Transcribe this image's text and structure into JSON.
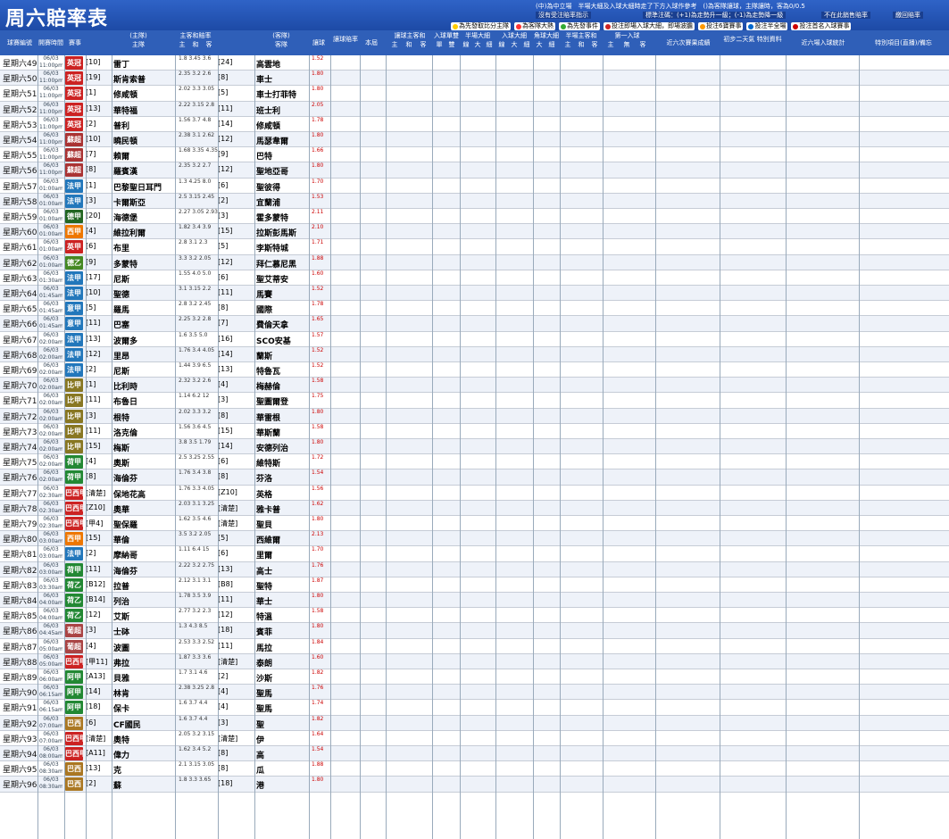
{
  "header": {
    "title": "周六賠率表",
    "note1": "(中)為中立場　半場大細及入球大細時走了下方入球作參考　()為客隊讓球，主隊讓時，客為0/0.5",
    "note2": "沒有受注賠率指示",
    "note3": "標準注碼：(+1)為走勢升一級；(-1)為走勢降一級",
    "note4": "不在此銷售賠率",
    "note5": "繳回賠率",
    "legend": [
      {
        "label": "為先發取比分主隊",
        "color": "#ffcc00"
      },
      {
        "label": "為客隊大熱",
        "color": "#ff3333"
      },
      {
        "label": "為先發事件",
        "color": "#33aa33"
      },
      {
        "label": "投注即場入球大細，即場波膽",
        "color": "#cc2222"
      },
      {
        "label": "投注6寶賽事",
        "color": "#ff9900"
      },
      {
        "label": "投注半全場",
        "color": "#0066cc"
      },
      {
        "label": "投注首名入球賽事",
        "color": "#cc0000"
      }
    ]
  },
  "columns": {
    "code": "球賽編號",
    "time": "開賽時間",
    "league": "賽事",
    "home_grp": "(主隊)",
    "home": "主隊",
    "odds1": "主客和賠率",
    "odds1_sub": [
      "主",
      "和",
      "客"
    ],
    "away_grp": "(客隊)",
    "away": "客隊",
    "hc": "讓球",
    "hcap": "讓球賠率",
    "hcap_sub": "讓球賠率",
    "hdiff": "本屆",
    "hilo_grp": "讓球主客和",
    "hilo_sub": [
      "主",
      "和",
      "客"
    ],
    "goal_grp": "入球單雙",
    "goal_sub": [
      "單",
      "雙"
    ],
    "half_grp": "半場大細",
    "half_sub": [
      "線",
      "大",
      "細"
    ],
    "tot_grp": "入球大細",
    "tot_sub": [
      "線",
      "大",
      "細"
    ],
    "first_grp": "角球大細",
    "first_sub": [
      "大",
      "細"
    ],
    "ht_grp": "半場主客和",
    "ht_sub": [
      "主",
      "和",
      "客"
    ],
    "corner_grp": "第一入球",
    "corner_sub": [
      "主",
      "無",
      "客"
    ],
    "recent": "近六次賽果成績",
    "adv": "初步二天氣 特別資料",
    "stars": "近六場入球統計",
    "special": "特別項目(直播)/備忘"
  },
  "row_template": {
    "date": "06/03",
    "ht": "主隊",
    "at": "客隊"
  },
  "matches": [
    {
      "code": "星期六49",
      "time": "11:00pm",
      "league": "英冠",
      "lc": "#cc2222",
      "hn": "[10]",
      "ht": "雷丁",
      "an": "[24]",
      "at": "高雲地",
      "hc": "1.52",
      "o": "1.8 3.45 3.6"
    },
    {
      "code": "星期六50",
      "time": "11:00pm",
      "league": "英冠",
      "lc": "#cc2222",
      "hn": "[19]",
      "ht": "斯肯索普",
      "an": "[8]",
      "at": "車士",
      "hc": "1.80",
      "o": "2.35 3.2 2.6"
    },
    {
      "code": "星期六51",
      "time": "11:00pm",
      "league": "英冠",
      "lc": "#cc2222",
      "hn": "[1]",
      "ht": "修咸頓",
      "an": "[5]",
      "at": "車士打菲特",
      "hc": "1.80",
      "o": "2.02 3.3 3.05"
    },
    {
      "code": "星期六52",
      "time": "11:00pm",
      "league": "英冠",
      "lc": "#cc2222",
      "hn": "[13]",
      "ht": "華特福",
      "an": "[11]",
      "at": "班士利",
      "hc": "2.05",
      "o": "2.22 3.15 2.8"
    },
    {
      "code": "星期六53",
      "time": "11:00pm",
      "league": "英冠",
      "lc": "#cc2222",
      "hn": "[2]",
      "ht": "普利",
      "an": "[14]",
      "at": "修咸頓",
      "hc": "1.78",
      "o": "1.56 3.7 4.8"
    },
    {
      "code": "星期六54",
      "time": "11:00pm",
      "league": "蘇超",
      "lc": "#aa3333",
      "hn": "[10]",
      "ht": "曉民頓",
      "an": "[12]",
      "at": "馬瑟韋爾",
      "hc": "1.80",
      "o": "2.38 3.1 2.62"
    },
    {
      "code": "星期六55",
      "time": "11:00pm",
      "league": "蘇超",
      "lc": "#aa3333",
      "hn": "[7]",
      "ht": "賴爾",
      "an": "[9]",
      "at": "巴特",
      "hc": "1.66",
      "o": "1.68 3.35 4.35"
    },
    {
      "code": "星期六56",
      "time": "11:00pm",
      "league": "蘇超",
      "lc": "#aa3333",
      "hn": "[8]",
      "ht": "羅賓漢",
      "an": "[12]",
      "at": "聖地亞哥",
      "hc": "1.80",
      "o": "2.35 3.2 2.7"
    },
    {
      "code": "星期六57",
      "time": "01:00am",
      "league": "法甲",
      "lc": "#2277bb",
      "hn": "[1]",
      "ht": "巴黎聖日耳門",
      "an": "[6]",
      "at": "聖彼得",
      "hc": "1.70",
      "o": "1.3 4.25 8.0"
    },
    {
      "code": "星期六58",
      "time": "01:00am",
      "league": "法甲",
      "lc": "#2277bb",
      "hn": "[3]",
      "ht": "卡爾斯亞",
      "an": "[2]",
      "at": "宜蘭浦",
      "hc": "1.53",
      "o": "2.5 3.15 2.45"
    },
    {
      "code": "星期六59",
      "time": "01:00am",
      "league": "德甲",
      "lc": "#226622",
      "hn": "[20]",
      "ht": "海德堡",
      "an": "[3]",
      "at": "霍多蒙特",
      "hc": "2.11",
      "o": "2.27 3.05 2.93"
    },
    {
      "code": "星期六60",
      "time": "01:00am",
      "league": "西甲",
      "lc": "#ee7700",
      "hn": "[4]",
      "ht": "維拉利爾",
      "an": "[15]",
      "at": "拉斯彭馬斯",
      "hc": "2.10",
      "o": "1.82 3.4 3.9"
    },
    {
      "code": "星期六61",
      "time": "01:00am",
      "league": "英甲",
      "lc": "#cc2222",
      "hn": "[6]",
      "ht": "布里",
      "an": "[5]",
      "at": "李斯特城",
      "hc": "1.71",
      "o": "2.8 3.1 2.3"
    },
    {
      "code": "星期六62",
      "time": "01:00am",
      "league": "德乙",
      "lc": "#448822",
      "hn": "[9]",
      "ht": "多蒙特",
      "an": "[12]",
      "at": "拜仁慕尼黑",
      "hc": "1.88",
      "o": "3.3 3.2 2.05"
    },
    {
      "code": "星期六63",
      "time": "01:30am",
      "league": "法甲",
      "lc": "#2277bb",
      "hn": "[17]",
      "ht": "尼斯",
      "an": "[6]",
      "at": "聖艾蒂安",
      "hc": "1.60",
      "o": "1.55 4.0 5.0"
    },
    {
      "code": "星期六64",
      "time": "01:45am",
      "league": "法甲",
      "lc": "#2277bb",
      "hn": "[10]",
      "ht": "聖德",
      "an": "[11]",
      "at": "馬賽",
      "hc": "1.52",
      "o": "3.1 3.15 2.2"
    },
    {
      "code": "星期六65",
      "time": "01:45am",
      "league": "意甲",
      "lc": "#2277bb",
      "hn": "[5]",
      "ht": "羅馬",
      "an": "[8]",
      "at": "國際",
      "hc": "1.78",
      "o": "2.8 3.2 2.45"
    },
    {
      "code": "星期六66",
      "time": "01:45am",
      "league": "意甲",
      "lc": "#2277bb",
      "hn": "[11]",
      "ht": "巴塞",
      "an": "[7]",
      "at": "費倫天拿",
      "hc": "1.65",
      "o": "2.25 3.2 2.8"
    },
    {
      "code": "星期六67",
      "time": "02:00am",
      "league": "法甲",
      "lc": "#2277bb",
      "hn": "[13]",
      "ht": "波爾多",
      "an": "[16]",
      "at": "SCO安基",
      "hc": "1.57",
      "o": "1.6 3.5 5.0"
    },
    {
      "code": "星期六68",
      "time": "02:00am",
      "league": "法甲",
      "lc": "#2277bb",
      "hn": "[12]",
      "ht": "里昂",
      "an": "[14]",
      "at": "蘭斯",
      "hc": "1.52",
      "o": "1.76 3.4 4.05"
    },
    {
      "code": "星期六69",
      "time": "02:00am",
      "league": "法甲",
      "lc": "#2277bb",
      "hn": "[2]",
      "ht": "尼斯",
      "an": "[13]",
      "at": "特魯瓦",
      "hc": "1.52",
      "o": "1.44 3.9 6.5"
    },
    {
      "code": "星期六70",
      "time": "02:00am",
      "league": "比甲",
      "lc": "#887722",
      "hn": "[1]",
      "ht": "比利時",
      "an": "[4]",
      "at": "梅赫倫",
      "hc": "1.58",
      "o": "2.32 3.2 2.6"
    },
    {
      "code": "星期六71",
      "time": "02:00am",
      "league": "比甲",
      "lc": "#887722",
      "hn": "[11]",
      "ht": "布魯日",
      "an": "[3]",
      "at": "聖圖爾登",
      "hc": "1.75",
      "o": "1.14 6.2 12"
    },
    {
      "code": "星期六72",
      "time": "02:00am",
      "league": "比甲",
      "lc": "#887722",
      "hn": "[3]",
      "ht": "根特",
      "an": "[8]",
      "at": "華雷根",
      "hc": "1.80",
      "o": "2.02 3.3 3.2"
    },
    {
      "code": "星期六73",
      "time": "02:00am",
      "league": "比甲",
      "lc": "#887722",
      "hn": "[11]",
      "ht": "洛克倫",
      "an": "[15]",
      "at": "華斯蘭",
      "hc": "1.58",
      "o": "1.56 3.6 4.5"
    },
    {
      "code": "星期六74",
      "time": "02:00am",
      "league": "比甲",
      "lc": "#887722",
      "hn": "[15]",
      "ht": "梅斯",
      "an": "[14]",
      "at": "安德列治",
      "hc": "1.80",
      "o": "3.8 3.5 1.79"
    },
    {
      "code": "星期六75",
      "time": "02:00am",
      "league": "荷甲",
      "lc": "#228833",
      "hn": "[4]",
      "ht": "奧斯",
      "an": "[6]",
      "at": "維特斯",
      "hc": "1.72",
      "o": "2.5 3.25 2.55"
    },
    {
      "code": "星期六76",
      "time": "02:00am",
      "league": "荷甲",
      "lc": "#228833",
      "hn": "[8]",
      "ht": "海倫芬",
      "an": "[8]",
      "at": "芬洛",
      "hc": "1.54",
      "o": "1.76 3.4 3.8"
    },
    {
      "code": "星期六77",
      "time": "02:30am",
      "league": "巴西甲",
      "lc": "#cc2222",
      "hn": "[清楚]",
      "ht": "保地花高",
      "an": "[Z10]",
      "at": "英格",
      "hc": "1.56",
      "o": "1.76 3.3 4.05"
    },
    {
      "code": "星期六78",
      "time": "02:30am",
      "league": "巴西甲",
      "lc": "#cc2222",
      "hn": "[Z10]",
      "ht": "奧華",
      "an": "[清楚]",
      "at": "雅卡普",
      "hc": "1.62",
      "o": "2.03 3.1 3.25"
    },
    {
      "code": "星期六79",
      "time": "02:30am",
      "league": "巴西甲",
      "lc": "#cc2222",
      "hn": "[甲4]",
      "ht": "聖保羅",
      "an": "[清楚]",
      "at": "聖貝",
      "hc": "1.80",
      "o": "1.62 3.5 4.6"
    },
    {
      "code": "星期六80",
      "time": "03:00am",
      "league": "西甲",
      "lc": "#ee7700",
      "hn": "[15]",
      "ht": "華倫",
      "an": "[5]",
      "at": "西維爾",
      "hc": "2.13",
      "o": "3.5 3.2 2.05"
    },
    {
      "code": "星期六81",
      "time": "03:00am",
      "league": "法甲",
      "lc": "#2277bb",
      "hn": "[2]",
      "ht": "摩納哥",
      "an": "[6]",
      "at": "里爾",
      "hc": "1.70",
      "o": "1.11 6.4 15"
    },
    {
      "code": "星期六82",
      "time": "03:00am",
      "league": "荷甲",
      "lc": "#228833",
      "hn": "[11]",
      "ht": "海倫芬",
      "an": "[13]",
      "at": "高士",
      "hc": "1.76",
      "o": "2.22 3.2 2.75"
    },
    {
      "code": "星期六83",
      "time": "03:30am",
      "league": "荷乙",
      "lc": "#228833",
      "hn": "[B12]",
      "ht": "拉普",
      "an": "[B8]",
      "at": "聖特",
      "hc": "1.87",
      "o": "2.12 3.1 3.1"
    },
    {
      "code": "星期六84",
      "time": "04:00am",
      "league": "荷乙",
      "lc": "#228833",
      "hn": "[B14]",
      "ht": "列治",
      "an": "[11]",
      "at": "華士",
      "hc": "1.80",
      "o": "1.78 3.5 3.9"
    },
    {
      "code": "星期六85",
      "time": "04:00am",
      "league": "荷乙",
      "lc": "#228833",
      "hn": "[12]",
      "ht": "艾斯",
      "an": "[12]",
      "at": "特溫",
      "hc": "1.58",
      "o": "2.77 3.2 2.3"
    },
    {
      "code": "星期六86",
      "time": "04:45am",
      "league": "葡超",
      "lc": "#aa4444",
      "hn": "[3]",
      "ht": "士砵",
      "an": "[18]",
      "at": "賓菲",
      "hc": "1.80",
      "o": "1.3 4.3 8.5"
    },
    {
      "code": "星期六87",
      "time": "05:00am",
      "league": "葡超",
      "lc": "#aa4444",
      "hn": "[4]",
      "ht": "波圖",
      "an": "[11]",
      "at": "馬拉",
      "hc": "1.84",
      "o": "2.53 3.3 2.52"
    },
    {
      "code": "星期六88",
      "time": "05:00am",
      "league": "巴西甲",
      "lc": "#cc2222",
      "hn": "[甲11]",
      "ht": "弗拉",
      "an": "[清楚]",
      "at": "泰朗",
      "hc": "1.60",
      "o": "1.87 3.3 3.6"
    },
    {
      "code": "星期六89",
      "time": "06:00am",
      "league": "阿甲",
      "lc": "#228833",
      "hn": "[A13]",
      "ht": "貝雅",
      "an": "[2]",
      "at": "沙斯",
      "hc": "1.82",
      "o": "1.7 3.1 4.6"
    },
    {
      "code": "星期六90",
      "time": "06:15am",
      "league": "阿甲",
      "lc": "#228833",
      "hn": "[14]",
      "ht": "林肯",
      "an": "[4]",
      "at": "聖馬",
      "hc": "1.76",
      "o": "2.38 3.25 2.8"
    },
    {
      "code": "星期六91",
      "time": "06:15am",
      "league": "阿甲",
      "lc": "#228833",
      "hn": "[18]",
      "ht": "保卡",
      "an": "[4]",
      "at": "聖馬",
      "hc": "1.74",
      "o": "1.6 3.7 4.4"
    },
    {
      "code": "星期六92",
      "time": "07:00am",
      "league": "巴西",
      "lc": "#aa7722",
      "hn": "[6]",
      "ht": "CF國民",
      "an": "[3]",
      "at": "聖",
      "hc": "1.82",
      "o": "1.6 3.7 4.4"
    },
    {
      "code": "星期六93",
      "time": "07:00am",
      "league": "巴西甲",
      "lc": "#cc2222",
      "hn": "[清楚]",
      "ht": "奧特",
      "an": "[清楚]",
      "at": "伊",
      "hc": "1.64",
      "o": "2.05 3.2 3.15"
    },
    {
      "code": "星期六94",
      "time": "08:00am",
      "league": "巴西甲",
      "lc": "#cc2222",
      "hn": "[A11]",
      "ht": "偉力",
      "an": "[8]",
      "at": "高",
      "hc": "1.54",
      "o": "1.62 3.4 5.2"
    },
    {
      "code": "星期六95",
      "time": "08:30am",
      "league": "巴西",
      "lc": "#aa7722",
      "hn": "[13]",
      "ht": "克",
      "an": "[8]",
      "at": "瓜",
      "hc": "1.88",
      "o": "2.1 3.15 3.05"
    },
    {
      "code": "星期六96",
      "time": "08:30am",
      "league": "巴西",
      "lc": "#aa7722",
      "hn": "[2]",
      "ht": "蘇",
      "an": "[18]",
      "at": "港",
      "hc": "1.80",
      "o": "1.8 3.3 3.65"
    }
  ]
}
